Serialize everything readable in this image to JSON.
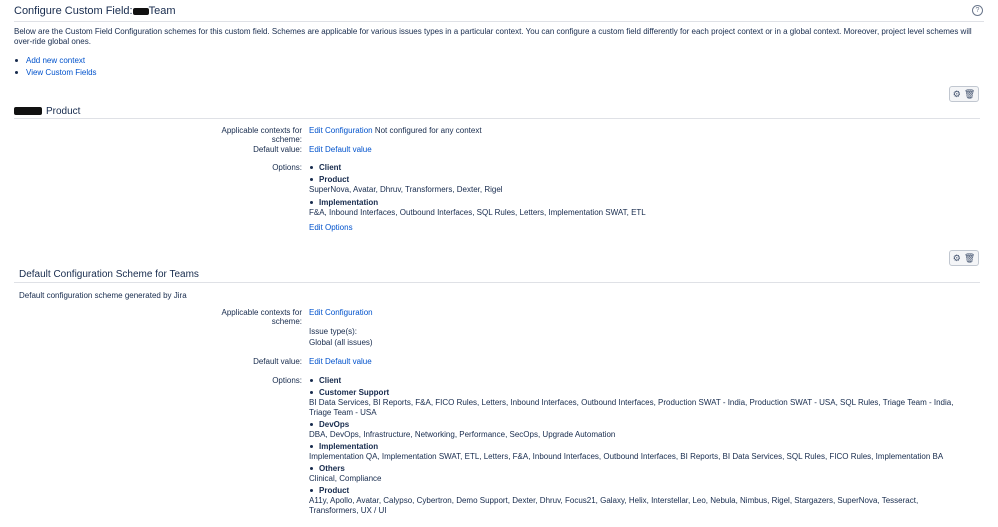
{
  "header": {
    "title_prefix": "Configure Custom Field: ",
    "title_suffix": "Team",
    "intro": "Below are the Custom Field Configuration schemes for this custom field. Schemes are applicable for various issues types in a particular context. You can configure a custom field differently for each project context or in a global context. Moreover, project level schemes will over-ride global ones.",
    "links": [
      "Add new context",
      "View Custom Fields"
    ],
    "help_glyph": "?"
  },
  "icons": {
    "gear": "gear-icon",
    "trash": "trash-icon",
    "help": "help-icon"
  },
  "labels": {
    "applicable_contexts": "Applicable contexts for scheme:",
    "default_value": "Default value:",
    "options": "Options:",
    "edit_configuration": "Edit Configuration",
    "edit_default_value": "Edit Default value",
    "edit_options": "Edit Options"
  },
  "scheme1": {
    "title": "Product",
    "context_note": "Not configured for any context",
    "options": [
      {
        "name": "Client",
        "children": ""
      },
      {
        "name": "Product",
        "children": "SuperNova, Avatar, Dhruv, Transformers, Dexter, Rigel"
      },
      {
        "name": "Implementation",
        "children": "F&A, Inbound Interfaces, Outbound Interfaces, SQL Rules, Letters, Implementation SWAT, ETL"
      }
    ]
  },
  "scheme2": {
    "title": "Default Configuration Scheme for Teams",
    "description": "Default configuration scheme generated by Jira",
    "issue_types_label": "Issue type(s):",
    "issue_types_value": "Global (all issues)",
    "options": [
      {
        "name": "Client",
        "children": ""
      },
      {
        "name": "Customer Support",
        "children": "BI Data Services, BI Reports, F&A, FICO Rules, Letters, Inbound Interfaces, Outbound Interfaces, Production SWAT - India, Production SWAT - USA, SQL Rules, Triage Team - India, Triage Team - USA"
      },
      {
        "name": "DevOps",
        "children": "DBA, DevOps, Infrastructure, Networking, Performance, SecOps, Upgrade Automation"
      },
      {
        "name": "Implementation",
        "children": "Implementation QA, Implementation SWAT, ETL, Letters, F&A, Inbound Interfaces, Outbound Interfaces, BI Reports, BI Data Services, SQL Rules, FICO Rules, Implementation BA"
      },
      {
        "name": "Others",
        "children": "Clinical, Compliance"
      },
      {
        "name": "Product",
        "children": "A11y, Apollo, Avatar, Calypso, Cybertron, Demo Support, Dexter, Dhruv, Focus21, Galaxy, Helix, Interstellar, Leo, Nebula, Nimbus, Rigel, Stargazers, SuperNova, Tesseract, Transformers, UX / UI"
      }
    ]
  }
}
